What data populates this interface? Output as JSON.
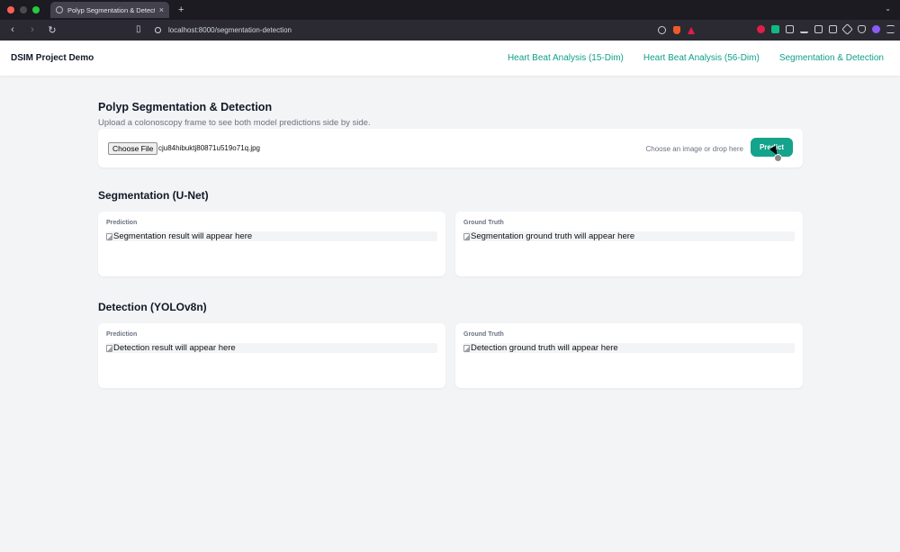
{
  "browser": {
    "tab_title": "Polyp Segmentation & Detection",
    "url": "localhost:8000/segmentation-detection",
    "traffic_colors": [
      "#ff5f57",
      "#febc2e",
      "#28c840"
    ]
  },
  "navbar": {
    "brand": "DSIM Project Demo",
    "links": [
      {
        "label": "Heart Beat Analysis (15-Dim)"
      },
      {
        "label": "Heart Beat Analysis (56-Dim)"
      },
      {
        "label": "Segmentation & Detection"
      }
    ],
    "link_color": "#0f9f8a"
  },
  "page": {
    "title": "Polyp Segmentation & Detection",
    "subtitle": "Upload a colonoscopy frame to see both model predictions side by side."
  },
  "upload": {
    "choose_label": "Choose File",
    "filename": "cju84hibuktj80871u519o71q.jpg",
    "hint": "Choose an image or drop here",
    "predict_label": "Predict",
    "accent": "#14a38b"
  },
  "segmentation": {
    "title": "Segmentation (U-Net)",
    "prediction": {
      "label": "Prediction",
      "alt": "Segmentation result will appear here"
    },
    "ground_truth": {
      "label": "Ground Truth",
      "alt": "Segmentation ground truth will appear here"
    }
  },
  "detection": {
    "title": "Detection (YOLOv8n)",
    "prediction": {
      "label": "Prediction",
      "alt": "Detection result will appear here"
    },
    "ground_truth": {
      "label": "Ground Truth",
      "alt": "Detection ground truth will appear here"
    }
  }
}
